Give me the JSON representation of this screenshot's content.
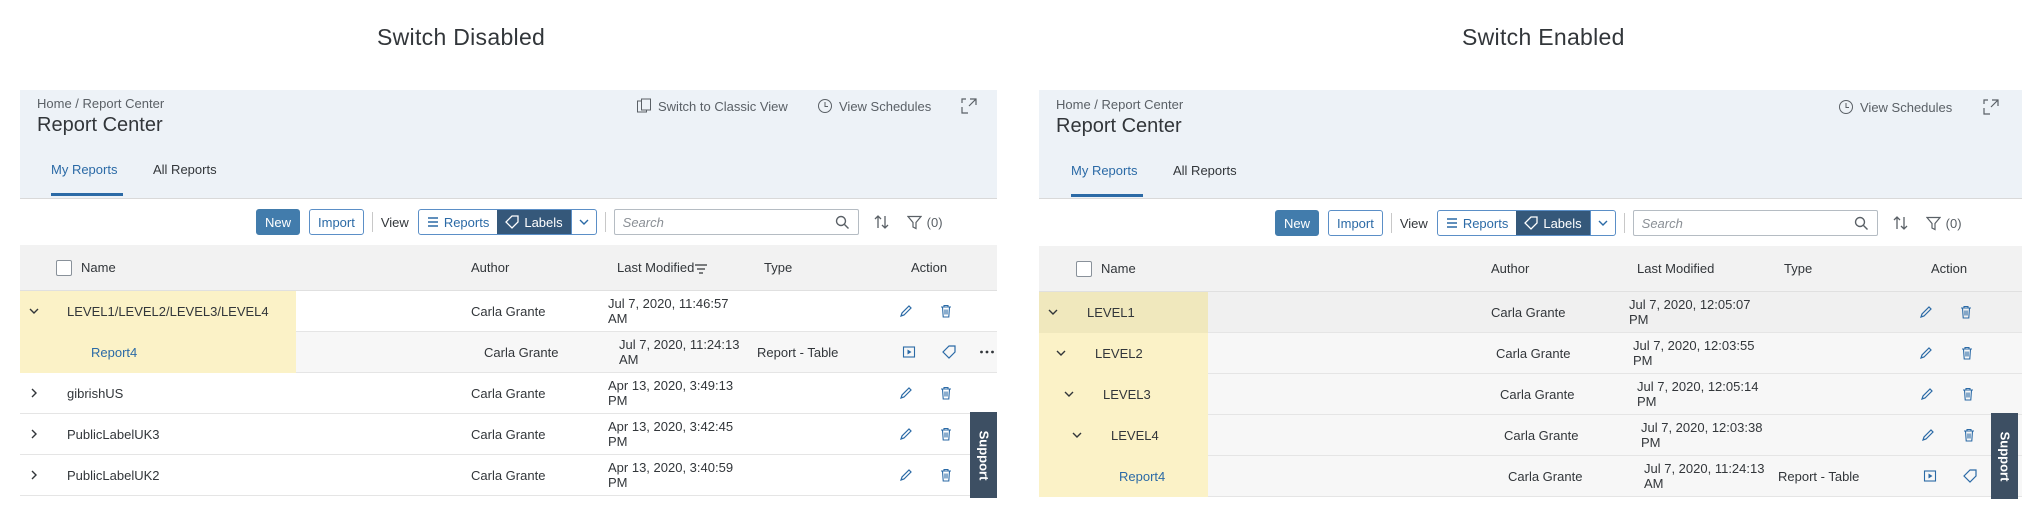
{
  "left": {
    "caption": "Switch Disabled",
    "breadcrumb": "Home / Report Center",
    "title": "Report Center",
    "header_actions": {
      "classic": "Switch to Classic View",
      "schedules": "View Schedules"
    },
    "tabs": [
      "My Reports",
      "All Reports"
    ],
    "toolbar": {
      "new": "New",
      "import": "Import",
      "view": "View",
      "reports": "Reports",
      "labels": "Labels",
      "search_placeholder": "Search",
      "filter": "(0)"
    },
    "columns": {
      "name": "Name",
      "author": "Author",
      "modified": "Last Modified",
      "type": "Type",
      "action": "Action"
    },
    "rows": [
      {
        "name": "LEVEL1/LEVEL2/LEVEL3/LEVEL4",
        "author": "Carla Grante",
        "modified": [
          "Jul 7, 2020, 11:46:57",
          "AM"
        ],
        "type": ""
      },
      {
        "name": "Report4",
        "author": "Carla Grante",
        "modified": [
          "Jul 7, 2020, 11:24:13",
          "AM"
        ],
        "type": "Report - Table"
      },
      {
        "name": "gibrishUS",
        "author": "Carla Grante",
        "modified": [
          "Apr 13, 2020, 3:49:13",
          "PM"
        ],
        "type": ""
      },
      {
        "name": "PublicLabelUK3",
        "author": "Carla Grante",
        "modified": [
          "Apr 13, 2020, 3:42:45",
          "PM"
        ],
        "type": ""
      },
      {
        "name": "PublicLabelUK2",
        "author": "Carla Grante",
        "modified": [
          "Apr 13, 2020, 3:40:59",
          "PM"
        ],
        "type": ""
      }
    ],
    "support": "Support"
  },
  "right": {
    "caption": "Switch Enabled",
    "breadcrumb": "Home / Report Center",
    "title": "Report Center",
    "header_actions": {
      "schedules": "View Schedules"
    },
    "tabs": [
      "My Reports",
      "All Reports"
    ],
    "toolbar": {
      "new": "New",
      "import": "Import",
      "view": "View",
      "reports": "Reports",
      "labels": "Labels",
      "search_placeholder": "Search",
      "filter": "(0)"
    },
    "columns": {
      "name": "Name",
      "author": "Author",
      "modified": "Last Modified",
      "type": "Type",
      "action": "Action"
    },
    "rows": [
      {
        "name": "LEVEL1",
        "author": "Carla Grante",
        "modified": [
          "Jul 7, 2020, 12:05:07",
          "PM"
        ],
        "type": ""
      },
      {
        "name": "LEVEL2",
        "author": "Carla Grante",
        "modified": [
          "Jul 7, 2020, 12:03:55",
          "PM"
        ],
        "type": ""
      },
      {
        "name": "LEVEL3",
        "author": "Carla Grante",
        "modified": [
          "Jul 7, 2020, 12:05:14",
          "PM"
        ],
        "type": ""
      },
      {
        "name": "LEVEL4",
        "author": "Carla Grante",
        "modified": [
          "Jul 7, 2020, 12:03:38",
          "PM"
        ],
        "type": ""
      },
      {
        "name": "Report4",
        "author": "Carla Grante",
        "modified": [
          "Jul 7, 2020, 11:24:13",
          "AM"
        ],
        "type": "Report - Table"
      }
    ],
    "support": "Support"
  },
  "colors": {
    "header_bg": "#edf2f7",
    "accent": "#2b6aa6",
    "selected_segment": "#35587a",
    "highlight": "#fbf2c7",
    "support_bg": "#3d4f63"
  }
}
